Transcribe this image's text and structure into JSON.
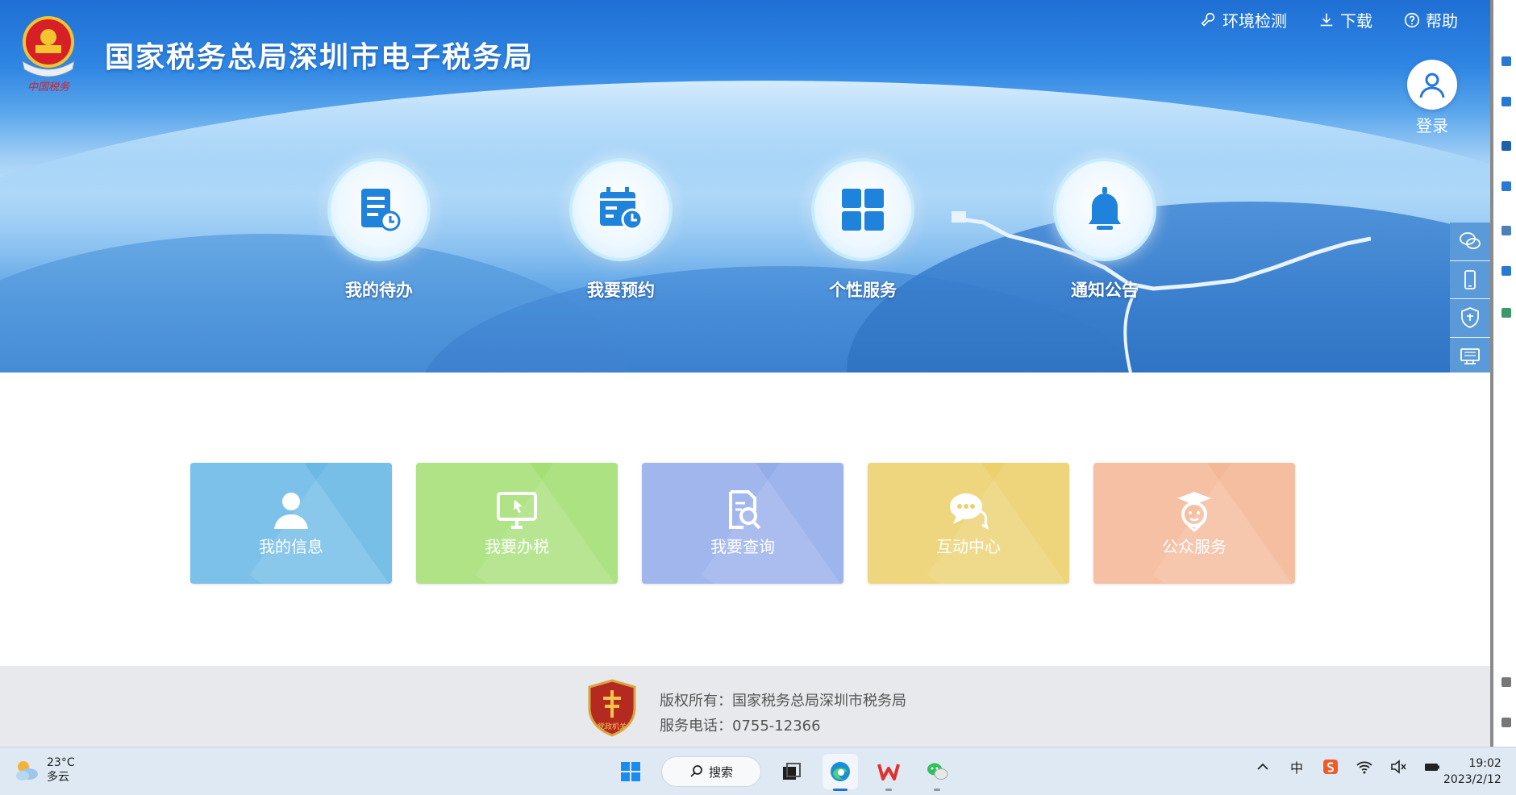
{
  "header": {
    "site_title": "国家税务总局深圳市电子税务局",
    "emblem_caption": "中国税务",
    "top_links": [
      {
        "label": "环境检测",
        "icon": "wrench-icon"
      },
      {
        "label": "下载",
        "icon": "download-icon"
      },
      {
        "label": "帮助",
        "icon": "help-icon"
      }
    ],
    "login_label": "登录"
  },
  "features": [
    {
      "label": "我的待办",
      "icon": "todo-list-icon"
    },
    {
      "label": "我要预约",
      "icon": "calendar-icon"
    },
    {
      "label": "个性服务",
      "icon": "grid-icon"
    },
    {
      "label": "通知公告",
      "icon": "bell-icon"
    }
  ],
  "side_tools": [
    {
      "icon": "wechat-icon"
    },
    {
      "icon": "mobile-icon"
    },
    {
      "icon": "tax-shield-icon"
    },
    {
      "icon": "terminal-icon"
    }
  ],
  "tiles": [
    {
      "label": "我的信息",
      "icon": "user-icon",
      "color": "#69b8e6"
    },
    {
      "label": "我要办税",
      "icon": "monitor-icon",
      "color": "#a4df74"
    },
    {
      "label": "我要查询",
      "icon": "doc-search-icon",
      "color": "#93acea"
    },
    {
      "label": "互动中心",
      "icon": "chat-icon",
      "color": "#ecd06c"
    },
    {
      "label": "公众服务",
      "icon": "graduate-icon",
      "color": "#f4b797"
    }
  ],
  "footer": {
    "copyright": "版权所有：国家税务总局深圳市税务局",
    "service_phone": "服务电话：0755-12366",
    "badge_caption": "党政机关"
  },
  "taskbar": {
    "weather_temp": "23°C",
    "weather_desc": "多云",
    "search_label": "搜索",
    "ime_label": "中",
    "time": "19:02",
    "date": "2023/2/12"
  },
  "colors": {
    "brand_blue": "#2178d6",
    "footer_bg": "#e7e9ec",
    "taskbar_bg": "#dfe9f3"
  }
}
